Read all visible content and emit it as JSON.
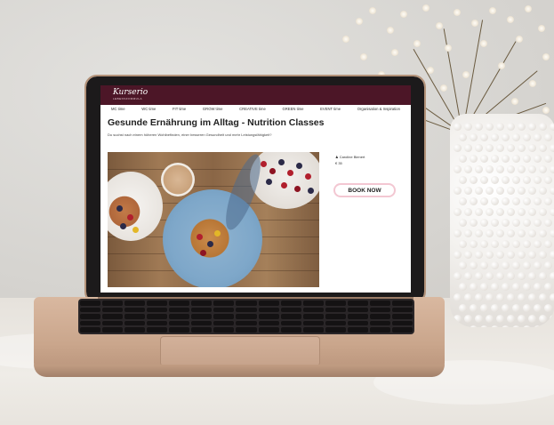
{
  "site": {
    "logo": "Kurserio",
    "logo_tagline": "LEBENSFORMULA",
    "menu": [
      "MC time",
      "WC time",
      "FIT time",
      "GROW time",
      "CREATIVE time",
      "GREEN time",
      "EVENT time",
      "Organisation & Inspiration"
    ],
    "course_title": "Gesunde Ernährung im Alltag - Nutrition Classes",
    "course_subtitle": "Du suchst nach einem höheren Wohlbefinden, einer besseren Gesundheit und mehr Leistungsfähigkeit?",
    "trainer": "Caroline Bienert",
    "price": "€ 35",
    "book_button": "BOOK NOW"
  },
  "colors": {
    "nav_bg": "#4c1627",
    "button_border": "#f3c7d2",
    "laptop": "#caa68c"
  },
  "icons": {
    "trainer": "person-icon"
  }
}
